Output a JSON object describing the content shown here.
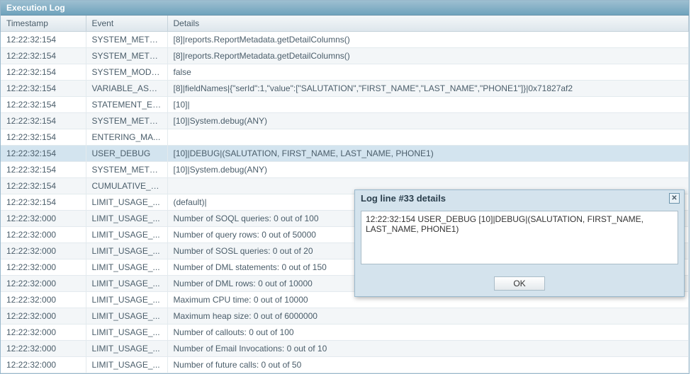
{
  "panel": {
    "title": "Execution Log"
  },
  "columns": {
    "timestamp": "Timestamp",
    "event": "Event",
    "details": "Details"
  },
  "rows": [
    {
      "ts": "12:22:32:154",
      "ev": "SYSTEM_METH...",
      "dt": "[8]|reports.ReportMetadata.getDetailColumns()"
    },
    {
      "ts": "12:22:32:154",
      "ev": "SYSTEM_METH...",
      "dt": "[8]|reports.ReportMetadata.getDetailColumns()"
    },
    {
      "ts": "12:22:32:154",
      "ev": "SYSTEM_MODE...",
      "dt": "false"
    },
    {
      "ts": "12:22:32:154",
      "ev": "VARIABLE_ASSI...",
      "dt": "[8]|fieldNames|{\"serId\":1,\"value\":[\"SALUTATION\",\"FIRST_NAME\",\"LAST_NAME\",\"PHONE1\"]}|0x71827af2"
    },
    {
      "ts": "12:22:32:154",
      "ev": "STATEMENT_EX...",
      "dt": "[10]|"
    },
    {
      "ts": "12:22:32:154",
      "ev": "SYSTEM_METH...",
      "dt": "[10]|System.debug(ANY)"
    },
    {
      "ts": "12:22:32:154",
      "ev": "ENTERING_MA...",
      "dt": ""
    },
    {
      "ts": "12:22:32:154",
      "ev": "USER_DEBUG",
      "dt": "[10]|DEBUG|(SALUTATION, FIRST_NAME, LAST_NAME, PHONE1)",
      "selected": true
    },
    {
      "ts": "12:22:32:154",
      "ev": "SYSTEM_METH...",
      "dt": "[10]|System.debug(ANY)"
    },
    {
      "ts": "12:22:32:154",
      "ev": "CUMULATIVE_L...",
      "dt": ""
    },
    {
      "ts": "12:22:32:154",
      "ev": "LIMIT_USAGE_...",
      "dt": "(default)|"
    },
    {
      "ts": "12:22:32:000",
      "ev": "LIMIT_USAGE_...",
      "dt": "Number of SOQL queries: 0 out of 100"
    },
    {
      "ts": "12:22:32:000",
      "ev": "LIMIT_USAGE_...",
      "dt": "Number of query rows: 0 out of 50000"
    },
    {
      "ts": "12:22:32:000",
      "ev": "LIMIT_USAGE_...",
      "dt": "Number of SOSL queries: 0 out of 20"
    },
    {
      "ts": "12:22:32:000",
      "ev": "LIMIT_USAGE_...",
      "dt": "Number of DML statements: 0 out of 150"
    },
    {
      "ts": "12:22:32:000",
      "ev": "LIMIT_USAGE_...",
      "dt": "Number of DML rows: 0 out of 10000"
    },
    {
      "ts": "12:22:32:000",
      "ev": "LIMIT_USAGE_...",
      "dt": "Maximum CPU time: 0 out of 10000"
    },
    {
      "ts": "12:22:32:000",
      "ev": "LIMIT_USAGE_...",
      "dt": "Maximum heap size: 0 out of 6000000"
    },
    {
      "ts": "12:22:32:000",
      "ev": "LIMIT_USAGE_...",
      "dt": "Number of callouts: 0 out of 100"
    },
    {
      "ts": "12:22:32:000",
      "ev": "LIMIT_USAGE_...",
      "dt": "Number of Email Invocations: 0 out of 10"
    },
    {
      "ts": "12:22:32:000",
      "ev": "LIMIT_USAGE_...",
      "dt": "Number of future calls: 0 out of 50"
    }
  ],
  "dialog": {
    "title": "Log line #33 details",
    "content": "12:22:32:154 USER_DEBUG [10]|DEBUG|(SALUTATION, FIRST_NAME, LAST_NAME, PHONE1)",
    "ok_label": "OK",
    "close_glyph": "✕"
  }
}
